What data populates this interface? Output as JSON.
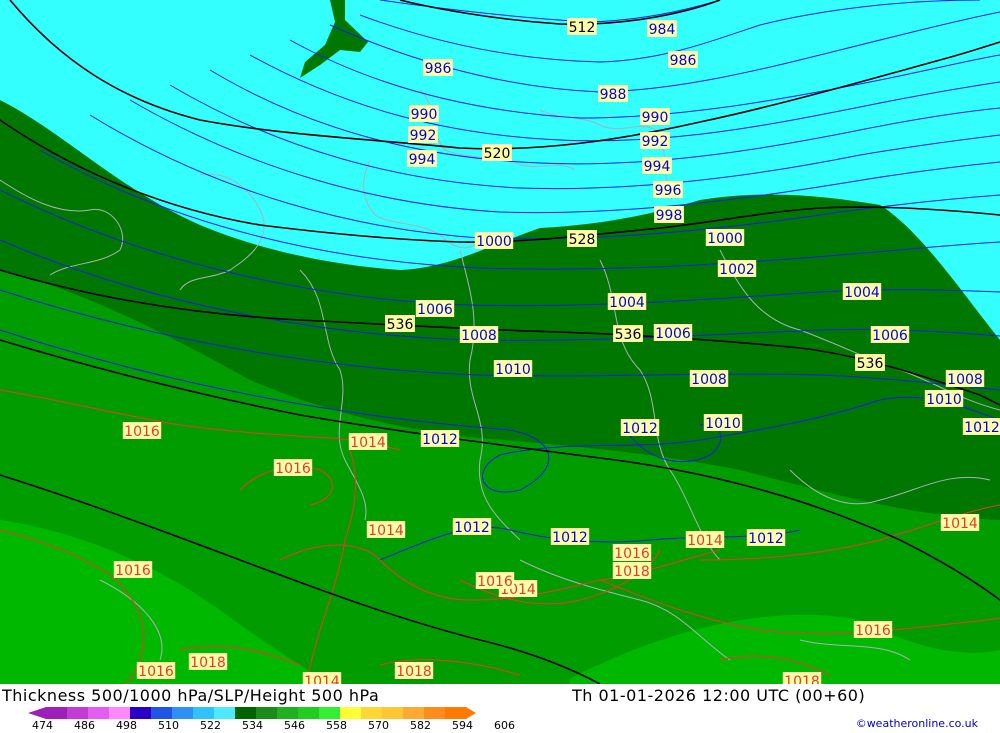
{
  "title": "Thickness 500/1000 hPa/SLP/Height 500 hPa",
  "valid_time": "Th 01-01-2026 12:00 UTC (00+60)",
  "credit": "©weatheronline.co.uk",
  "legend": {
    "ticks": [
      "474",
      "486",
      "498",
      "510",
      "522",
      "534",
      "546",
      "558",
      "570",
      "582",
      "594",
      "606"
    ],
    "colors": [
      "#9b1fb8",
      "#c43ad6",
      "#e45cf0",
      "#ff88ff",
      "#2a00c8",
      "#1f55e6",
      "#2e8ff5",
      "#30c2ff",
      "#4de9ff",
      "#006400",
      "#1a8c1a",
      "#20b020",
      "#22cc22",
      "#33ee33",
      "#ffff33",
      "#ffd633",
      "#ffc633",
      "#ffa833",
      "#ff8c1a",
      "#ff7a00"
    ]
  },
  "map_colors": {
    "cyan": "#33ffff",
    "dark_green": "#007700",
    "mid_green": "#009c00",
    "light_green": "#00b800",
    "isobar_blue": "#0000ee",
    "isobar_red": "#e83a2a",
    "height_black": "#000000",
    "label_bg": "#ffffa8"
  },
  "labels": [
    {
      "text": "512",
      "kind": "height"
    },
    {
      "text": "520",
      "kind": "height"
    },
    {
      "text": "528",
      "kind": "height"
    },
    {
      "text": "536",
      "kind": "height"
    },
    {
      "text": "536",
      "kind": "height"
    },
    {
      "text": "536",
      "kind": "height"
    },
    {
      "text": "984",
      "kind": "slp"
    },
    {
      "text": "986",
      "kind": "slp"
    },
    {
      "text": "986",
      "kind": "slp"
    },
    {
      "text": "988",
      "kind": "slp"
    },
    {
      "text": "990",
      "kind": "slp"
    },
    {
      "text": "990",
      "kind": "slp"
    },
    {
      "text": "992",
      "kind": "slp"
    },
    {
      "text": "992",
      "kind": "slp"
    },
    {
      "text": "994",
      "kind": "slp"
    },
    {
      "text": "994",
      "kind": "slp"
    },
    {
      "text": "996",
      "kind": "slp"
    },
    {
      "text": "998",
      "kind": "slp"
    },
    {
      "text": "1000",
      "kind": "slp"
    },
    {
      "text": "1000",
      "kind": "slp"
    },
    {
      "text": "1002",
      "kind": "slp"
    },
    {
      "text": "1004",
      "kind": "slp"
    },
    {
      "text": "1004",
      "kind": "slp"
    },
    {
      "text": "1006",
      "kind": "slp"
    },
    {
      "text": "1006",
      "kind": "slp"
    },
    {
      "text": "1006",
      "kind": "slp"
    },
    {
      "text": "1008",
      "kind": "slp"
    },
    {
      "text": "1008",
      "kind": "slp"
    },
    {
      "text": "1008",
      "kind": "slp"
    },
    {
      "text": "1010",
      "kind": "slp"
    },
    {
      "text": "1010",
      "kind": "slp"
    },
    {
      "text": "1010",
      "kind": "slp"
    },
    {
      "text": "1012",
      "kind": "slp"
    },
    {
      "text": "1012",
      "kind": "slp"
    },
    {
      "text": "1012",
      "kind": "slp"
    },
    {
      "text": "1012",
      "kind": "slp"
    },
    {
      "text": "1012",
      "kind": "slp"
    },
    {
      "text": "1012",
      "kind": "slp"
    },
    {
      "text": "1014",
      "kind": "slp-red"
    },
    {
      "text": "1014",
      "kind": "slp-red"
    },
    {
      "text": "1014",
      "kind": "slp-red"
    },
    {
      "text": "1014",
      "kind": "slp-red"
    },
    {
      "text": "1014",
      "kind": "slp-red"
    },
    {
      "text": "1014",
      "kind": "slp-red"
    },
    {
      "text": "1016",
      "kind": "slp-red"
    },
    {
      "text": "1016",
      "kind": "slp-red"
    },
    {
      "text": "1016",
      "kind": "slp-red"
    },
    {
      "text": "1016",
      "kind": "slp-red"
    },
    {
      "text": "1016",
      "kind": "slp-red"
    },
    {
      "text": "1016",
      "kind": "slp-red"
    },
    {
      "text": "1016",
      "kind": "slp-red"
    },
    {
      "text": "1018",
      "kind": "slp-red"
    },
    {
      "text": "1018",
      "kind": "slp-red"
    },
    {
      "text": "1018",
      "kind": "slp-red"
    },
    {
      "text": "1018",
      "kind": "slp-red"
    }
  ]
}
